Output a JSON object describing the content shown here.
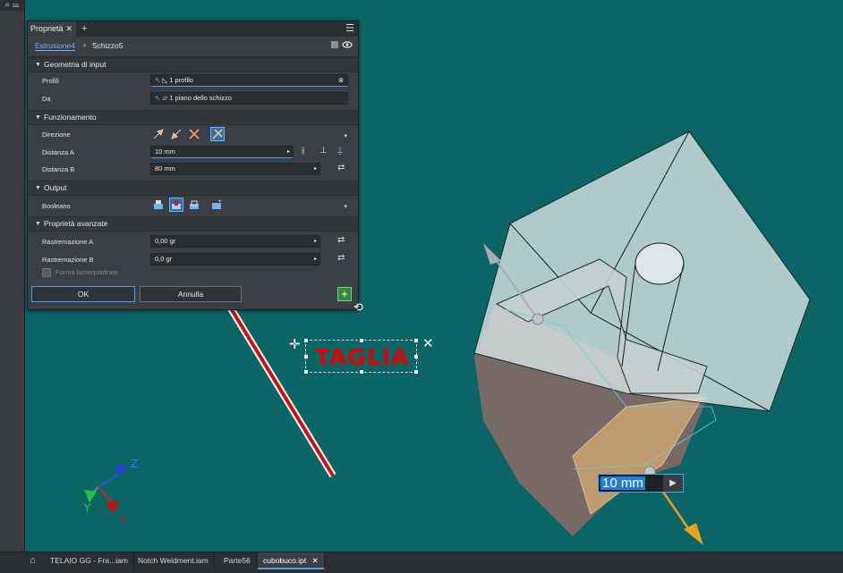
{
  "panel": {
    "tab_label": "Proprietà",
    "tab_close": "✕",
    "tab_add": "+",
    "menu": "☰",
    "breadcrumb": {
      "feature": "Estrusione4",
      "separator": "›",
      "sketch": "Schizzo5"
    },
    "sections": {
      "input_geometry": "Geometria di input",
      "behavior": "Funzionamento",
      "output": "Output",
      "advanced": "Proprietà avanzate"
    },
    "profiles": {
      "label": "Profili",
      "value": "1 profilo"
    },
    "from": {
      "label": "Da",
      "value": "1 piano dello schizzo"
    },
    "direction": {
      "label": "Direzione"
    },
    "distance_a": {
      "label": "Distanza A",
      "value": "10 mm"
    },
    "distance_b": {
      "label": "Distanza B",
      "value": "80 mm"
    },
    "boolean": {
      "label": "Booleano"
    },
    "taper_a": {
      "label": "Rastremazione A",
      "value": "0,00 gr"
    },
    "taper_b": {
      "label": "Rastremazione B",
      "value": "0,0 gr"
    },
    "checkbox_label": "Forma lumaquadrate",
    "ok": "OK",
    "cancel": "Annulla",
    "add": "+"
  },
  "annotation": {
    "text": "TAGLIA"
  },
  "dimension_input": {
    "value": "10 mm",
    "arrow": "▶"
  },
  "triad": {
    "x": "X",
    "y": "Y",
    "z": "Z"
  },
  "document_tabs": [
    {
      "label": "TELAIO GG - Fra...iam"
    },
    {
      "label": "Notch Weldment.iam"
    },
    {
      "label": "Parte56"
    },
    {
      "label": "cubobuco.ipt",
      "close": "✕"
    }
  ],
  "colors": {
    "viewport": "#0b6565",
    "accent": "#4aa0e6",
    "annotation": "#e00000",
    "arrow": "#e8a020"
  }
}
